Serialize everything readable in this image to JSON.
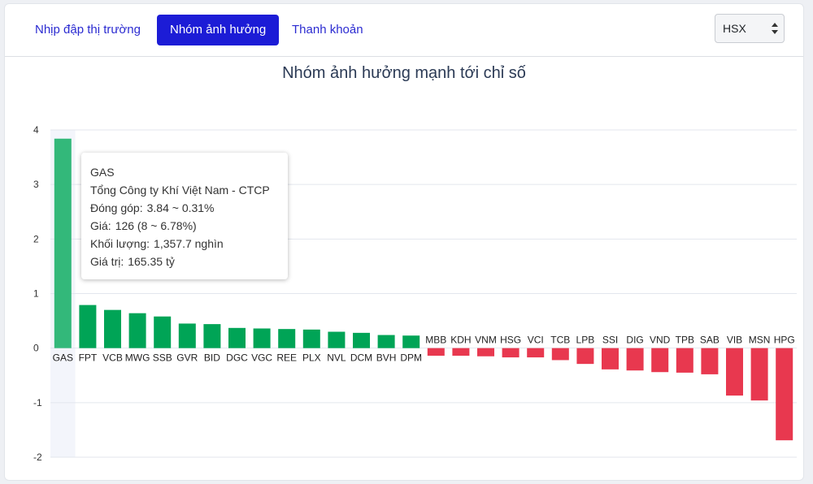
{
  "tabs": [
    {
      "label": "Nhịp đập thị trường",
      "active": false
    },
    {
      "label": "Nhóm ảnh hưởng",
      "active": true
    },
    {
      "label": "Thanh khoản",
      "active": false
    }
  ],
  "exchange_select": {
    "value": "HSX"
  },
  "colors": {
    "positive": "#00a456",
    "positive_hover": "#33b87a",
    "negative": "#e8384f",
    "accent": "#1c1cd6"
  },
  "tooltip": {
    "symbol": "GAS",
    "company": "Tổng Công ty Khí Việt Nam - CTCP",
    "contribution_label": "Đóng góp:",
    "contribution_value": "3.84 ~ 0.31%",
    "price_label": "Giá:",
    "price_value": "126 (8 ~ 6.78%)",
    "volume_label": "Khối lượng:",
    "volume_value": "1,357.7 nghìn",
    "value_label": "Giá trị:",
    "value_value": "165.35 tỷ"
  },
  "chart_data": {
    "type": "bar",
    "title": "Nhóm ảnh hưởng mạnh tới chỉ số",
    "xlabel": "",
    "ylabel": "",
    "ylim": [
      -2,
      4
    ],
    "yticks": [
      4,
      3,
      2,
      1,
      0,
      -1,
      -2
    ],
    "grid": true,
    "highlighted": "GAS",
    "categories": [
      "GAS",
      "FPT",
      "VCB",
      "MWG",
      "SSB",
      "GVR",
      "BID",
      "DGC",
      "VGC",
      "REE",
      "PLX",
      "NVL",
      "DCM",
      "BVH",
      "DPM",
      "MBB",
      "KDH",
      "VNM",
      "HSG",
      "VCI",
      "TCB",
      "LPB",
      "SSI",
      "DIG",
      "VND",
      "TPB",
      "SAB",
      "VIB",
      "MSN",
      "HPG"
    ],
    "values": [
      3.84,
      0.79,
      0.7,
      0.64,
      0.58,
      0.45,
      0.44,
      0.37,
      0.36,
      0.35,
      0.34,
      0.3,
      0.28,
      0.24,
      0.23,
      -0.14,
      -0.14,
      -0.15,
      -0.17,
      -0.17,
      -0.22,
      -0.29,
      -0.39,
      -0.41,
      -0.44,
      -0.45,
      -0.48,
      -0.87,
      -0.96,
      -1.69
    ]
  }
}
